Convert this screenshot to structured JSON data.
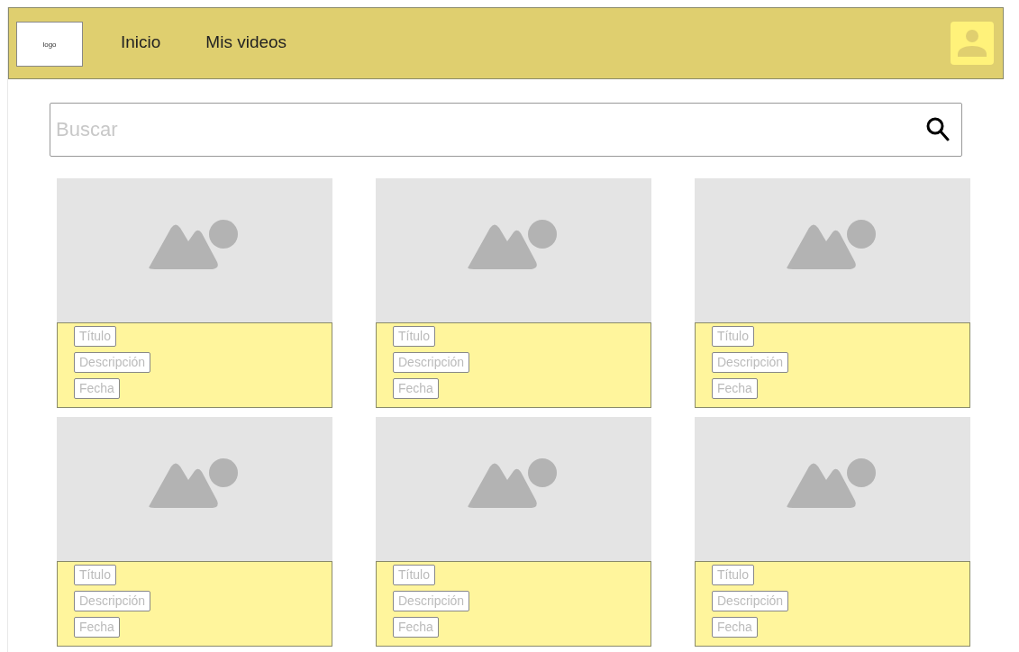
{
  "header": {
    "logo": "logo",
    "nav": [
      {
        "label": "Inicio"
      },
      {
        "label": "Mis videos"
      }
    ]
  },
  "search": {
    "placeholder": "Buscar"
  },
  "cards": [
    {
      "kind": "picture",
      "title": "Título",
      "description": "Descripción",
      "date": "Fecha"
    },
    {
      "kind": "picture",
      "title": "Título",
      "description": "Descripción",
      "date": "Fecha"
    },
    {
      "kind": "picture",
      "title": "Título",
      "description": "Descripción",
      "date": "Fecha"
    },
    {
      "kind": "picture",
      "title": "Título",
      "description": "Descripción",
      "date": "Fecha"
    },
    {
      "kind": "picture",
      "title": "Título",
      "description": "Descripción",
      "date": "Fecha"
    },
    {
      "kind": "picture",
      "title": "Título",
      "description": "Descripción",
      "date": "Fecha"
    }
  ]
}
